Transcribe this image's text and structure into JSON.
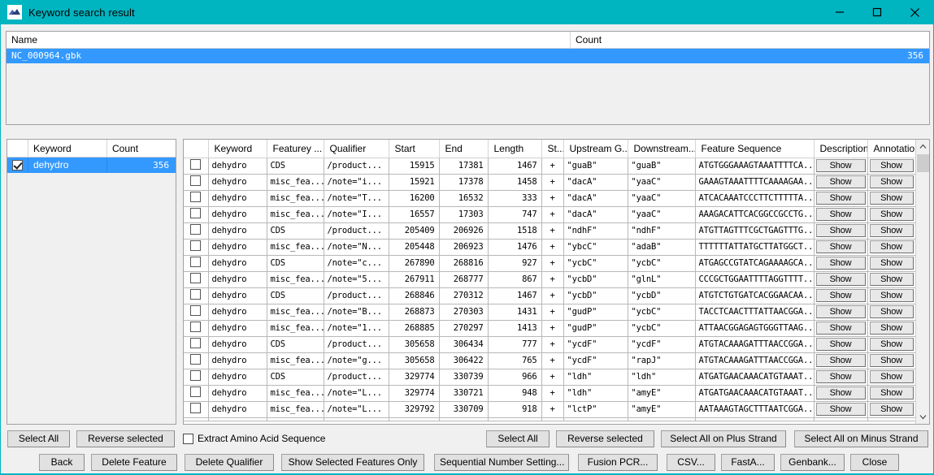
{
  "window": {
    "title": "Keyword search result",
    "icon": "app-mountain-icon",
    "accent_color": "#00b4c0",
    "controls": {
      "minimize": "minimize-icon",
      "maximize": "maximize-icon",
      "close": "close-icon"
    }
  },
  "top_list": {
    "columns": [
      "Name",
      "Count"
    ],
    "rows": [
      {
        "name": "NC_000964.gbk",
        "count": "356"
      }
    ]
  },
  "keyword_panel": {
    "columns": [
      "",
      "Keyword",
      "Count"
    ],
    "rows": [
      {
        "checked": true,
        "keyword": "dehydro",
        "count": "356"
      }
    ],
    "buttons": {
      "select_all": "Select All",
      "reverse_selected": "Reverse selected"
    }
  },
  "feature_table": {
    "columns": [
      "",
      "Keyword",
      "Featurey ...",
      "Qualifier",
      "Start",
      "End",
      "Length",
      "St...",
      "Upstream G...",
      "Downstream...",
      "Feature Sequence",
      "Description",
      "Annotatio..."
    ],
    "button_label": "Show",
    "rows": [
      {
        "checked": false,
        "keyword": "dehydro",
        "feature": "CDS",
        "qualifier": "/product...",
        "start": "15915",
        "end": "17381",
        "length": "1467",
        "strand": "+",
        "upstream": "\"guaB\"",
        "downstream": "\"guaB\"",
        "sequence": "ATGTGGGAAAGTAAATTTTCA...",
        "description": "Show",
        "annotation": "Show"
      },
      {
        "checked": false,
        "keyword": "dehydro",
        "feature": "misc_fea...",
        "qualifier": "/note=\"i...",
        "start": "15921",
        "end": "17378",
        "length": "1458",
        "strand": "+",
        "upstream": "\"dacA\"",
        "downstream": "\"yaaC\"",
        "sequence": "GAAAGTAAATTTTCAAAAGAA...",
        "description": "Show",
        "annotation": "Show"
      },
      {
        "checked": false,
        "keyword": "dehydro",
        "feature": "misc_fea...",
        "qualifier": "/note=\"T...",
        "start": "16200",
        "end": "16532",
        "length": "333",
        "strand": "+",
        "upstream": "\"dacA\"",
        "downstream": "\"yaaC\"",
        "sequence": "ATCACAAATCCCTTCTTTTTA...",
        "description": "Show",
        "annotation": "Show"
      },
      {
        "checked": false,
        "keyword": "dehydro",
        "feature": "misc_fea...",
        "qualifier": "/note=\"I...",
        "start": "16557",
        "end": "17303",
        "length": "747",
        "strand": "+",
        "upstream": "\"dacA\"",
        "downstream": "\"yaaC\"",
        "sequence": "AAAGACATTCACGGCCGCCTG...",
        "description": "Show",
        "annotation": "Show"
      },
      {
        "checked": false,
        "keyword": "dehydro",
        "feature": "CDS",
        "qualifier": "/product...",
        "start": "205409",
        "end": "206926",
        "length": "1518",
        "strand": "+",
        "upstream": "\"ndhF\"",
        "downstream": "\"ndhF\"",
        "sequence": "ATGTTAGTTTCGCTGAGTTTG...",
        "description": "Show",
        "annotation": "Show"
      },
      {
        "checked": false,
        "keyword": "dehydro",
        "feature": "misc_fea...",
        "qualifier": "/note=\"N...",
        "start": "205448",
        "end": "206923",
        "length": "1476",
        "strand": "+",
        "upstream": "\"ybcC\"",
        "downstream": "\"adaB\"",
        "sequence": "TTTTTTATTATGCTTATGGCT...",
        "description": "Show",
        "annotation": "Show"
      },
      {
        "checked": false,
        "keyword": "dehydro",
        "feature": "CDS",
        "qualifier": "/note=\"c...",
        "start": "267890",
        "end": "268816",
        "length": "927",
        "strand": "+",
        "upstream": "\"ycbC\"",
        "downstream": "\"ycbC\"",
        "sequence": "ATGAGCCGTATCAGAAAAGCA...",
        "description": "Show",
        "annotation": "Show"
      },
      {
        "checked": false,
        "keyword": "dehydro",
        "feature": "misc_fea...",
        "qualifier": "/note=\"5...",
        "start": "267911",
        "end": "268777",
        "length": "867",
        "strand": "+",
        "upstream": "\"ycbD\"",
        "downstream": "\"glnL\"",
        "sequence": "CCCGCTGGAATTTTAGGTTTT...",
        "description": "Show",
        "annotation": "Show"
      },
      {
        "checked": false,
        "keyword": "dehydro",
        "feature": "CDS",
        "qualifier": "/product...",
        "start": "268846",
        "end": "270312",
        "length": "1467",
        "strand": "+",
        "upstream": "\"ycbD\"",
        "downstream": "\"ycbD\"",
        "sequence": "ATGTCTGTGATCACGGAACAA...",
        "description": "Show",
        "annotation": "Show"
      },
      {
        "checked": false,
        "keyword": "dehydro",
        "feature": "misc_fea...",
        "qualifier": "/note=\"B...",
        "start": "268873",
        "end": "270303",
        "length": "1431",
        "strand": "+",
        "upstream": "\"gudP\"",
        "downstream": "\"ycbC\"",
        "sequence": "TACCTCAACTTTATTAACGGA...",
        "description": "Show",
        "annotation": "Show"
      },
      {
        "checked": false,
        "keyword": "dehydro",
        "feature": "misc_fea...",
        "qualifier": "/note=\"1...",
        "start": "268885",
        "end": "270297",
        "length": "1413",
        "strand": "+",
        "upstream": "\"gudP\"",
        "downstream": "\"ycbC\"",
        "sequence": "ATTAACGGAGAGTGGGTTAAG...",
        "description": "Show",
        "annotation": "Show"
      },
      {
        "checked": false,
        "keyword": "dehydro",
        "feature": "CDS",
        "qualifier": "/product...",
        "start": "305658",
        "end": "306434",
        "length": "777",
        "strand": "+",
        "upstream": "\"ycdF\"",
        "downstream": "\"ycdF\"",
        "sequence": "ATGTACAAAGATTTAACCGGA...",
        "description": "Show",
        "annotation": "Show"
      },
      {
        "checked": false,
        "keyword": "dehydro",
        "feature": "misc_fea...",
        "qualifier": "/note=\"g...",
        "start": "305658",
        "end": "306422",
        "length": "765",
        "strand": "+",
        "upstream": "\"ycdF\"",
        "downstream": "\"rapJ\"",
        "sequence": "ATGTACAAAGATTTAACCGGA...",
        "description": "Show",
        "annotation": "Show"
      },
      {
        "checked": false,
        "keyword": "dehydro",
        "feature": "CDS",
        "qualifier": "/product...",
        "start": "329774",
        "end": "330739",
        "length": "966",
        "strand": "+",
        "upstream": "\"ldh\"",
        "downstream": "\"ldh\"",
        "sequence": "ATGATGAACAAACATGTAAAT...",
        "description": "Show",
        "annotation": "Show"
      },
      {
        "checked": false,
        "keyword": "dehydro",
        "feature": "misc_fea...",
        "qualifier": "/note=\"L...",
        "start": "329774",
        "end": "330721",
        "length": "948",
        "strand": "+",
        "upstream": "\"ldh\"",
        "downstream": "\"amyE\"",
        "sequence": "ATGATGAACAAACATGTAAAT...",
        "description": "Show",
        "annotation": "Show"
      },
      {
        "checked": false,
        "keyword": "dehydro",
        "feature": "misc_fea...",
        "qualifier": "/note=\"L...",
        "start": "329792",
        "end": "330709",
        "length": "918",
        "strand": "+",
        "upstream": "\"lctP\"",
        "downstream": "\"amyE\"",
        "sequence": "AATAAAGTAGCTTTAATCGGA...",
        "description": "Show",
        "annotation": "Show"
      }
    ],
    "buttons": {
      "select_all": "Select All",
      "reverse_selected": "Reverse selected",
      "select_plus": "Select All on Plus Strand",
      "select_minus": "Select All on Minus Strand"
    }
  },
  "options": {
    "extract_amino_acid": {
      "label": "Extract Amino Acid Sequence",
      "checked": false
    }
  },
  "action_bar": {
    "buttons": [
      "Back",
      "Delete Feature",
      "Delete Qualifier",
      "Show Selected Features Only",
      "Sequential Number Setting...",
      "Fusion PCR...",
      "CSV...",
      "FastA...",
      "Genbank...",
      "Close"
    ]
  }
}
